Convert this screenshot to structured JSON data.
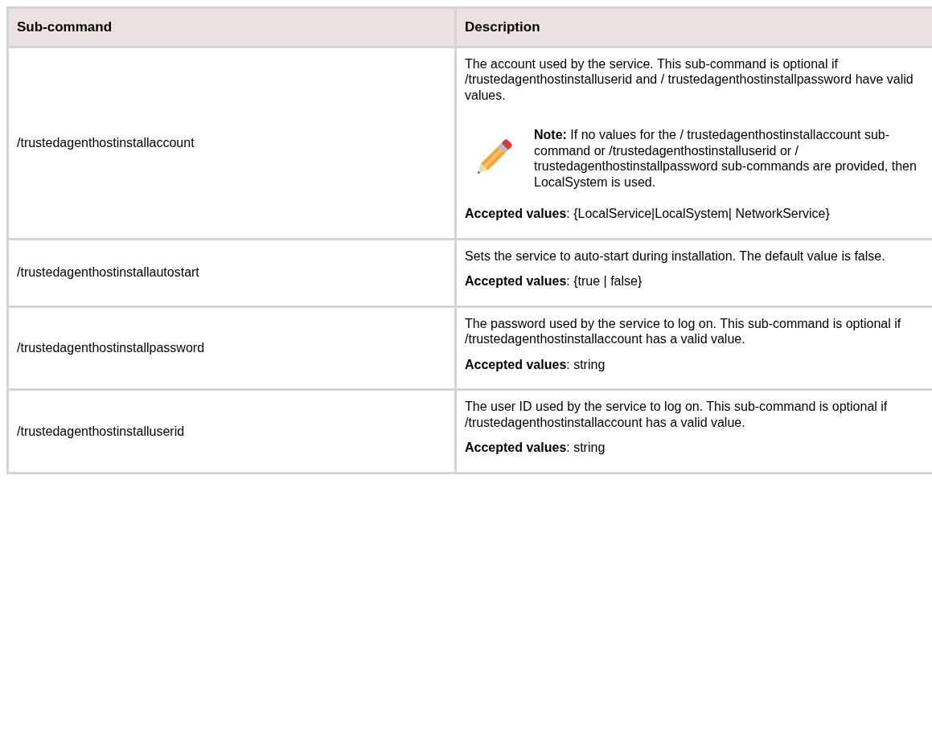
{
  "table": {
    "columns": [
      "Sub-command",
      "Description"
    ],
    "rows": [
      {
        "subcommand": "/trustedagenthostinstallaccount",
        "description": [
          {
            "kind": "paragraph",
            "text": "The account used by the service. This sub-command is optional if /trustedagenthostinstalluserid and / trustedagenthostinstallpassword have valid values."
          },
          {
            "kind": "note",
            "text": "**Note:** If no values for the / trustedagenthostinstallaccount sub-command or /trustedagenthostinstalluserid or / trustedagenthostinstallpassword sub-commands are provided, then LocalSystem is used."
          },
          {
            "kind": "paragraph",
            "text": "**Accepted values**: {LocalService|LocalSystem| NetworkService}"
          }
        ]
      },
      {
        "subcommand": "/trustedagenthostinstallautostart",
        "description": [
          {
            "kind": "paragraph",
            "text": "Sets the service to auto-start during installation. The default value is false."
          },
          {
            "kind": "paragraph",
            "text": "**Accepted values**: {true | false}"
          }
        ]
      },
      {
        "subcommand": "/trustedagenthostinstallpassword",
        "description": [
          {
            "kind": "paragraph",
            "text": "The password used by the service to log on. This sub-command is optional if /trustedagenthostinstallaccount has a valid value."
          },
          {
            "kind": "paragraph",
            "text": "**Accepted values**: string"
          }
        ]
      },
      {
        "subcommand": "/trustedagenthostinstalluserid",
        "description": [
          {
            "kind": "paragraph",
            "text": "The user ID used by the service to log on. This sub-command is optional if /trustedagenthostinstallaccount has a valid value."
          },
          {
            "kind": "paragraph",
            "text": "**Accepted values**: string"
          }
        ]
      }
    ]
  }
}
